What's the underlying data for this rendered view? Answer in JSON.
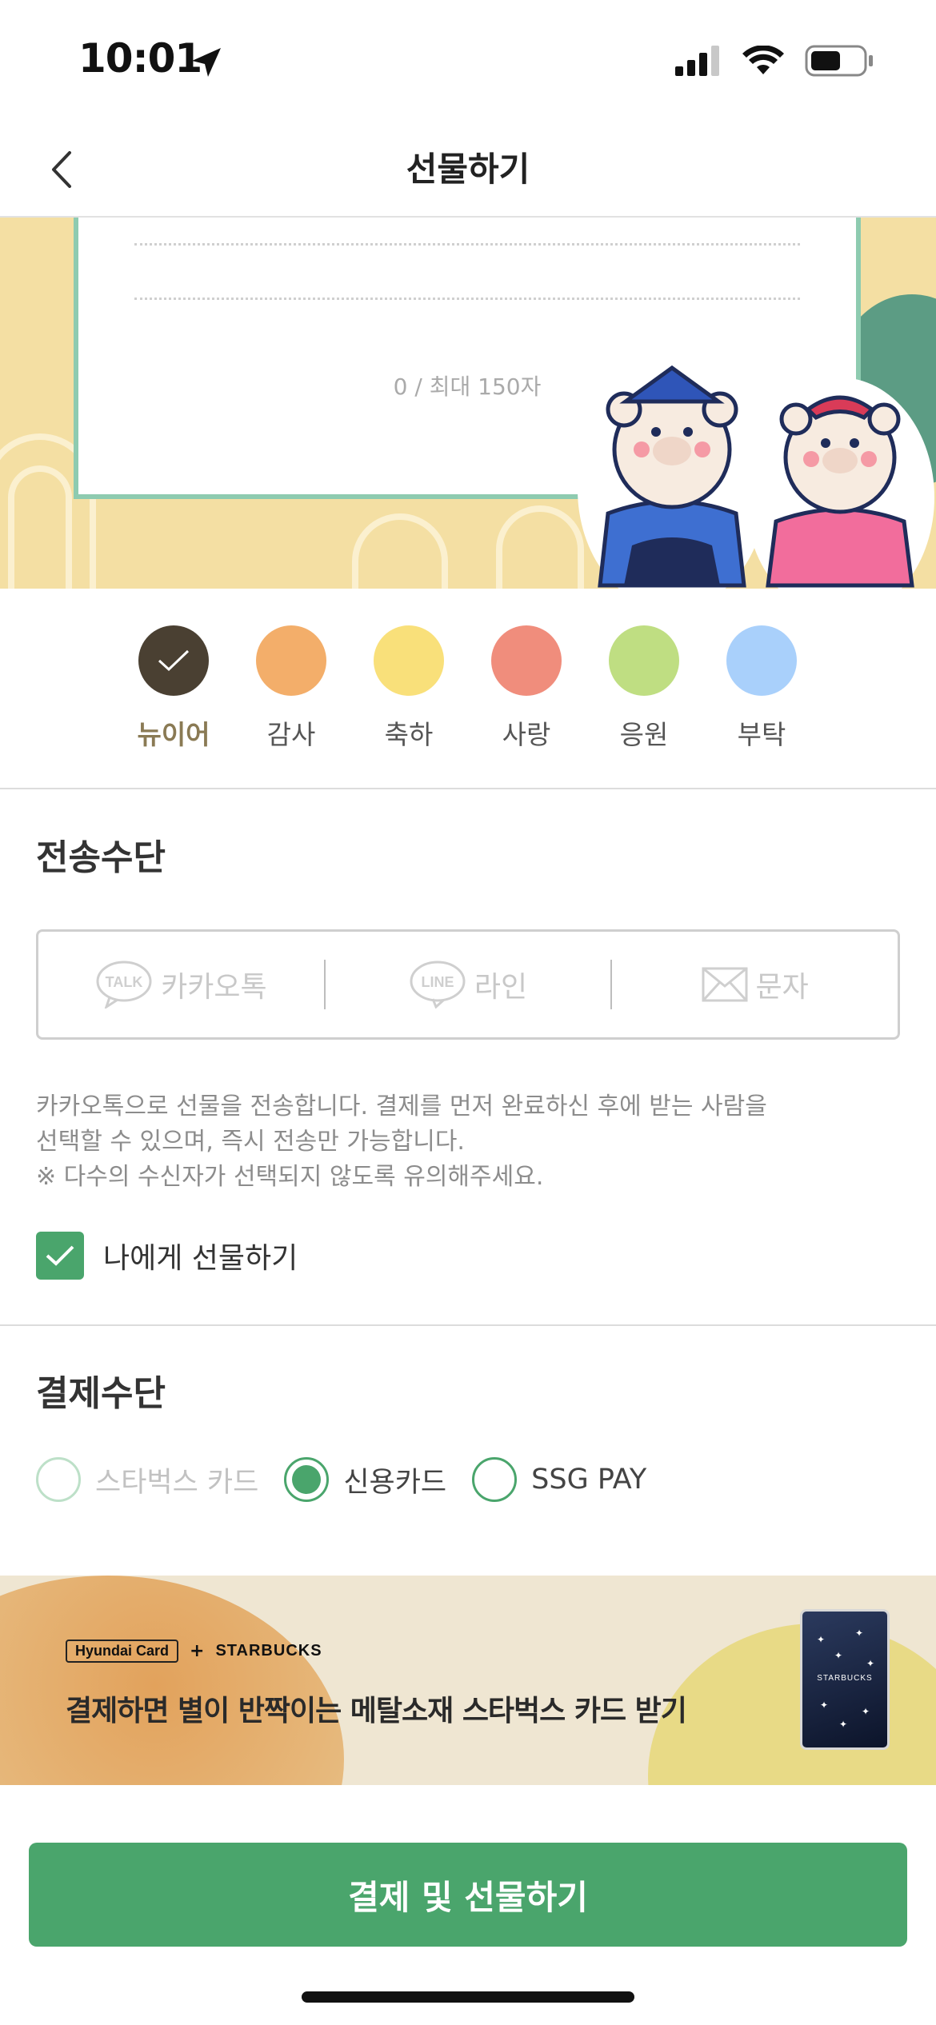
{
  "status_bar": {
    "time": "10:01"
  },
  "header": {
    "title": "선물하기"
  },
  "card": {
    "char_count": "0 / 최대 150자"
  },
  "themes": [
    {
      "label": "뉴이어",
      "color": "#4a4032",
      "selected": true
    },
    {
      "label": "감사",
      "color": "#f3ae6a",
      "selected": false
    },
    {
      "label": "축하",
      "color": "#f9e07a",
      "selected": false
    },
    {
      "label": "사랑",
      "color": "#f08d7c",
      "selected": false
    },
    {
      "label": "응원",
      "color": "#bfde82",
      "selected": false
    },
    {
      "label": "부탁",
      "color": "#a9d0fb",
      "selected": false
    }
  ],
  "send": {
    "title": "전송수단",
    "options": [
      "카카오톡",
      "라인",
      "문자"
    ],
    "icons": [
      "talk-icon",
      "line-icon",
      "envelope-icon"
    ],
    "talk_badge": "TALK",
    "line_badge": "LINE",
    "notice_line1": "카카오톡으로 선물을 전송합니다. 결제를 먼저 완료하신 후에 받는 사람을",
    "notice_line2": "선택할 수 있으며, 즉시 전송만 가능합니다.",
    "notice_line3": "※ 다수의 수신자가 선택되지 않도록 유의해주세요.",
    "self_gift_label": "나에게 선물하기",
    "self_gift_checked": true
  },
  "payment": {
    "title": "결제수단",
    "options": [
      {
        "label": "스타벅스 카드",
        "state": "disabled"
      },
      {
        "label": "신용카드",
        "state": "selected"
      },
      {
        "label": "SSG PAY",
        "state": "unselected"
      }
    ]
  },
  "banner": {
    "partner": "Hyundai Card",
    "plus": "+",
    "brand": "STARBUCKS",
    "card_brand": "STARBUCKS",
    "headline": "결제하면 별이 반짝이는 메탈소재 스타벅스 카드 받기"
  },
  "cta": {
    "label": "결제 및 선물하기"
  },
  "colors": {
    "accent": "#4aa56c",
    "card_bg": "#f4dfa3",
    "card_border": "#8ecbb0"
  }
}
